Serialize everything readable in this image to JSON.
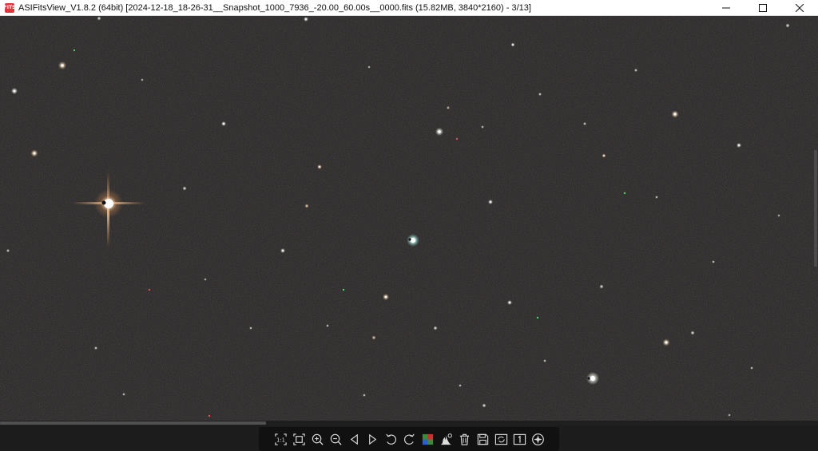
{
  "titlebar": {
    "app_icon_text": "FITS",
    "title": "ASIFitsView_V1.8.2 (64bit) [2024-12-18_18-26-31__Snapshot_1000_7936_-20.00_60.00s__0000.fits (15.82MB, 3840*2160) - 3/13]",
    "buttons": [
      "minimize-icon",
      "maximize-icon",
      "close-icon"
    ]
  },
  "image": {
    "kind": "astronomical star field",
    "background_color": "#262424"
  },
  "toolbar": {
    "icons": [
      "actual-size-icon",
      "fit-window-icon",
      "zoom-in-icon",
      "zoom-out-icon",
      "previous-icon",
      "next-icon",
      "rotate-left-icon",
      "rotate-right-icon",
      "debayer-icon",
      "histogram-icon",
      "delete-icon",
      "save-icon",
      "convert-icon",
      "single-view-icon",
      "stretch-icon"
    ]
  }
}
